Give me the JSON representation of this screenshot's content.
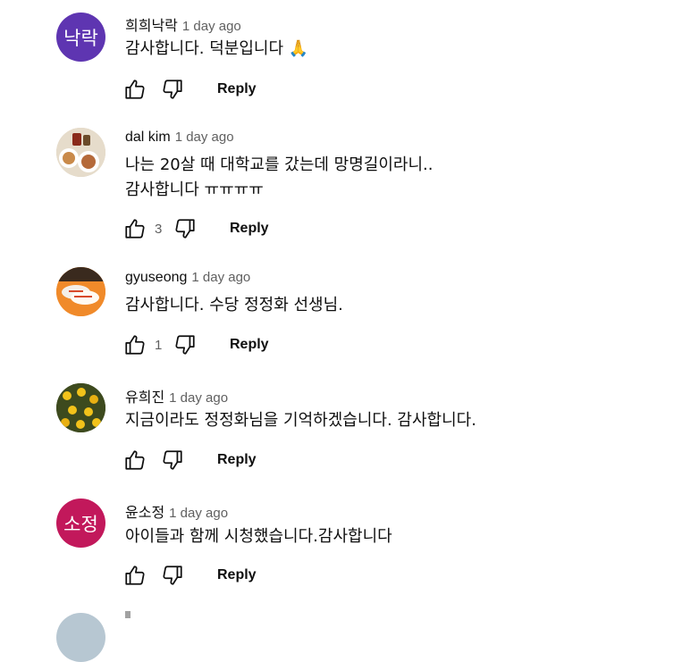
{
  "comments": [
    {
      "author": "희희낙락",
      "time": "1 day ago",
      "lines": [
        "감사합니다. 덕분입니다 🙏"
      ],
      "avatar": {
        "initials": "낙락",
        "color": "#5e35b1"
      },
      "likes": "",
      "reply_label": "Reply"
    },
    {
      "author": "dal kim",
      "time": "1 day ago",
      "lines": [
        "나는 20살 때 대학교를 갔는데 망명길이라니..",
        "감사합니다 ㅠㅠㅠㅠ"
      ],
      "avatar": {
        "initials": "",
        "color": "#c9b79a"
      },
      "likes": "3",
      "reply_label": "Reply"
    },
    {
      "author": "gyuseong",
      "time": "1 day ago",
      "lines": [
        "감사합니다. 수당 정정화 선생님."
      ],
      "avatar": {
        "initials": "",
        "color": "#f08a2a"
      },
      "likes": "1",
      "reply_label": "Reply"
    },
    {
      "author": "유희진",
      "time": "1 day ago",
      "lines": [
        "지금이라도 정정화님을 기억하겠습니다. 감사합니다."
      ],
      "avatar": {
        "initials": "",
        "color": "#3d4a1e"
      },
      "likes": "",
      "reply_label": "Reply"
    },
    {
      "author": "윤소정",
      "time": "1 day ago",
      "lines": [
        "아이들과 함께 시청했습니다.감사합니다"
      ],
      "avatar": {
        "initials": "소정",
        "color": "#c2185b"
      },
      "likes": "",
      "reply_label": "Reply"
    }
  ],
  "icons": {
    "like": "thumb-up-icon",
    "dislike": "thumb-down-icon"
  }
}
